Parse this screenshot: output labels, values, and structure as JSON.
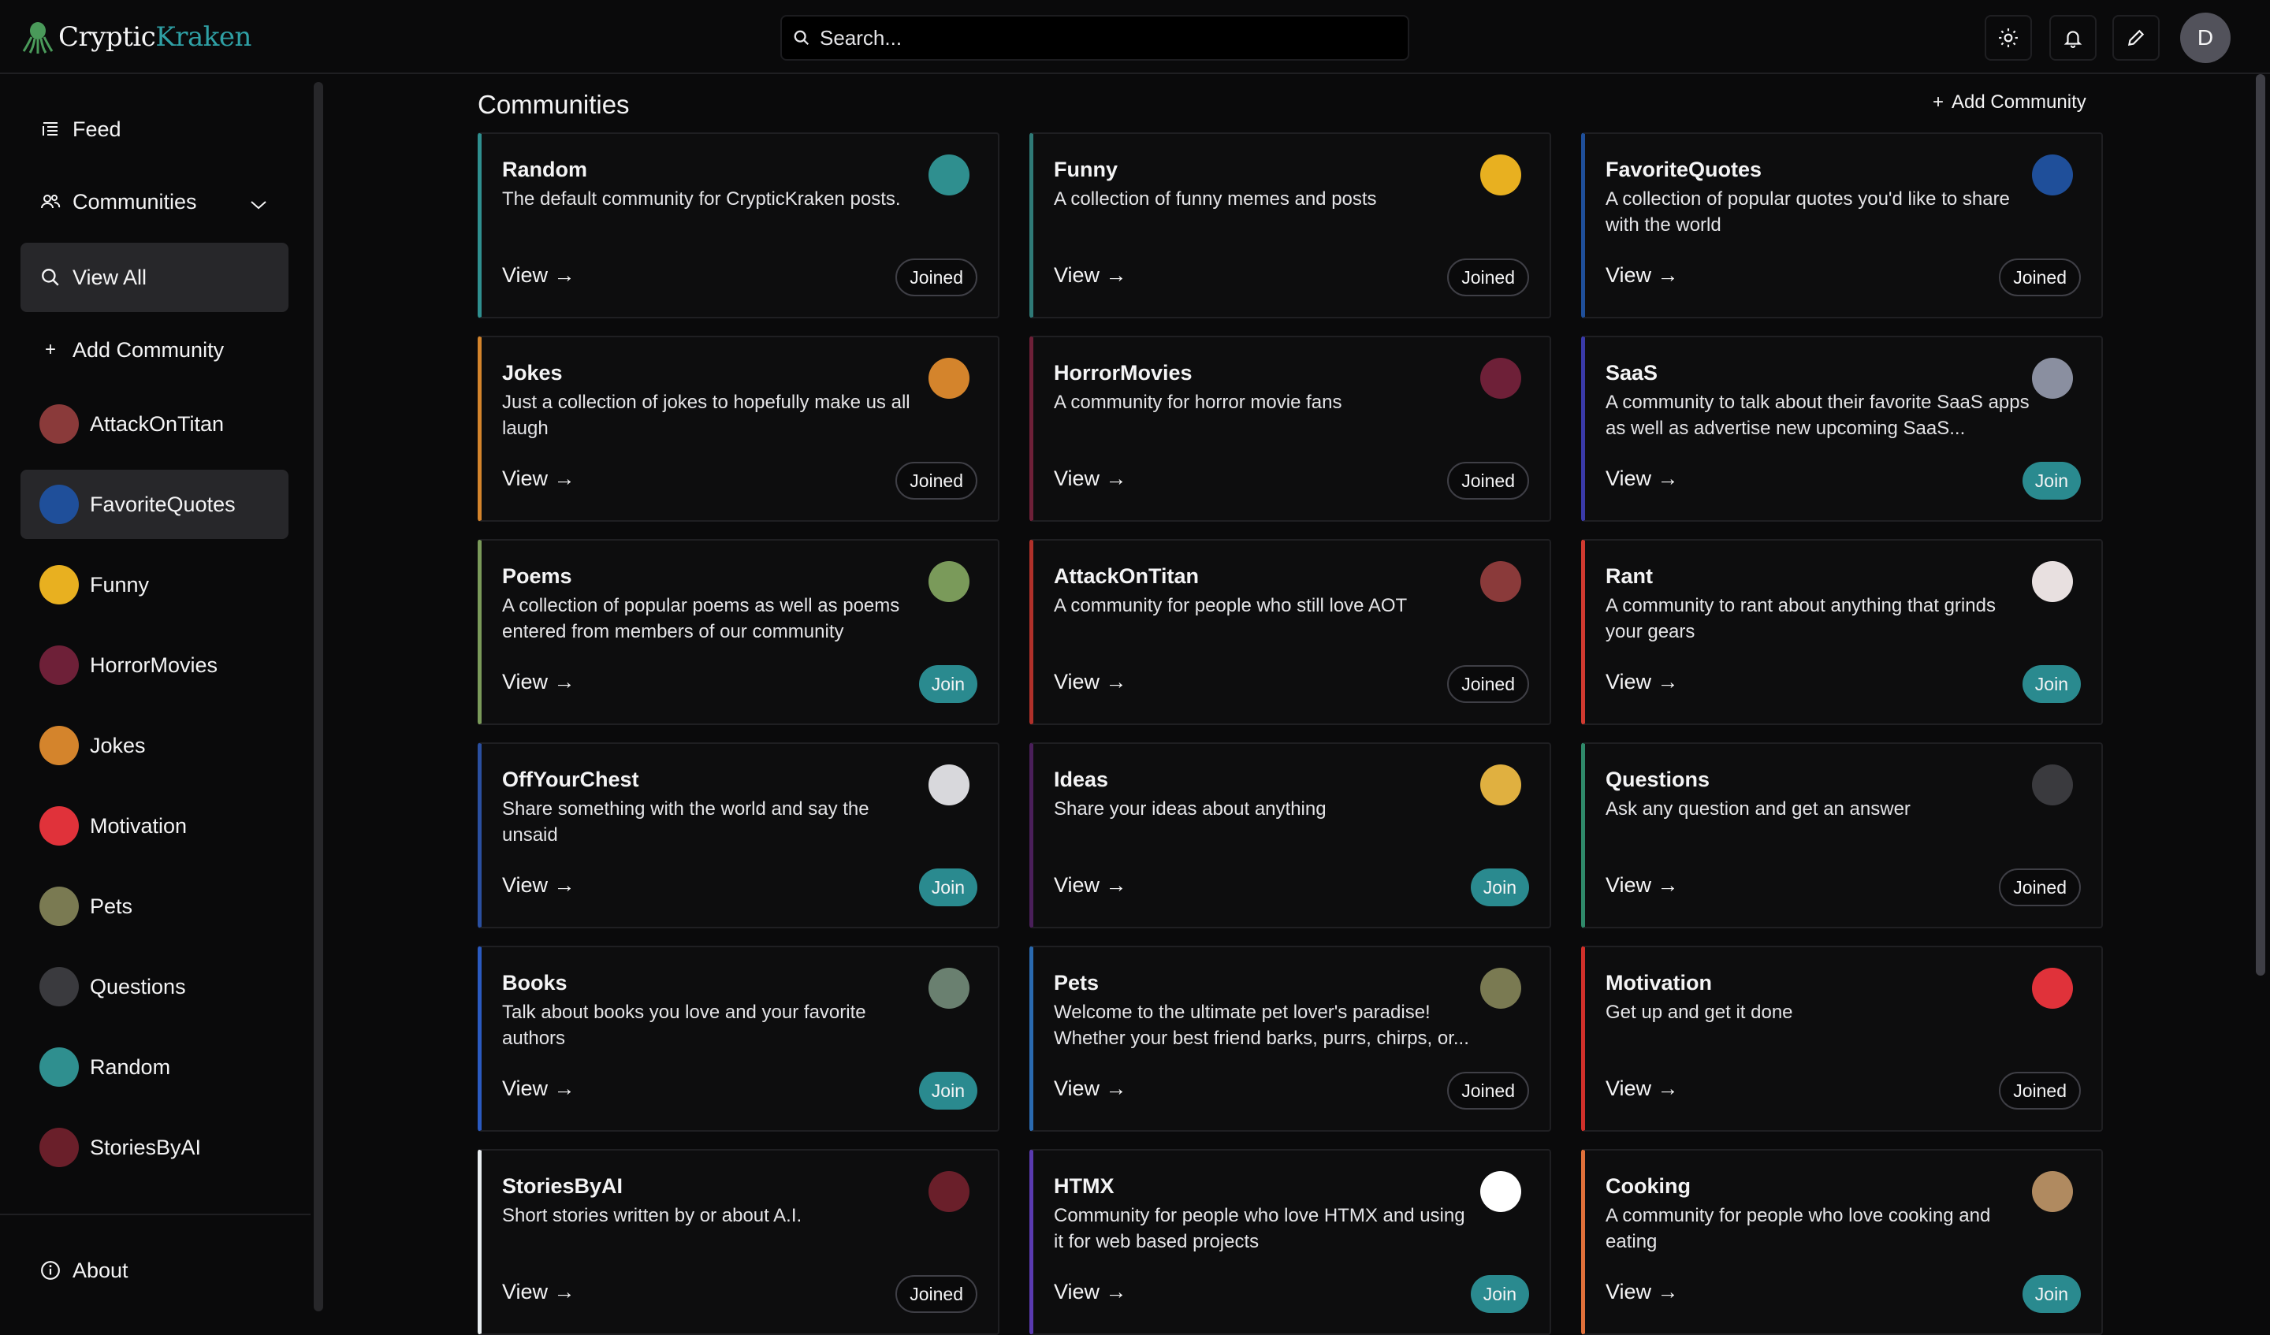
{
  "header": {
    "logo_a": "Cryptic",
    "logo_b": "Kraken",
    "search_placeholder": "Search...",
    "avatar_initial": "D",
    "icons": [
      "sun-icon",
      "bell-icon",
      "pencil-icon"
    ]
  },
  "sidebar": {
    "feed_label": "Feed",
    "communities_label": "Communities",
    "view_all_label": "View All",
    "add_community_label": "Add Community",
    "about_label": "About",
    "communities": [
      {
        "label": "AttackOnTitan",
        "color": "#8a3a3a"
      },
      {
        "label": "FavoriteQuotes",
        "color": "#1f4f9a"
      },
      {
        "label": "Funny",
        "color": "#e8b020"
      },
      {
        "label": "HorrorMovies",
        "color": "#6e2038"
      },
      {
        "label": "Jokes",
        "color": "#d4842c"
      },
      {
        "label": "Motivation",
        "color": "#e0323a"
      },
      {
        "label": "Pets",
        "color": "#7a7a52"
      },
      {
        "label": "Questions",
        "color": "#3a3a3e"
      },
      {
        "label": "Random",
        "color": "#2f8f8f"
      },
      {
        "label": "StoriesByAI",
        "color": "#6a1f2a"
      }
    ]
  },
  "main": {
    "title": "Communities",
    "add_community_label": "Add Community",
    "view_label": "View →",
    "cards": [
      {
        "name": "Random",
        "desc": "The default community for CrypticKraken posts.",
        "action": "Joined",
        "accent": "#2f8f8f",
        "avatar": "#2f8f8f"
      },
      {
        "name": "Funny",
        "desc": "A collection of funny memes and posts",
        "action": "Joined",
        "accent": "#2f7a77",
        "avatar": "#e8b020"
      },
      {
        "name": "FavoriteQuotes",
        "desc": "A collection of popular quotes you'd like to share with the world",
        "action": "Joined",
        "accent": "#1f4f9a",
        "avatar": "#1f4f9a"
      },
      {
        "name": "Jokes",
        "desc": "Just a collection of jokes to hopefully make us all laugh",
        "action": "Joined",
        "accent": "#d4842c",
        "avatar": "#d4842c"
      },
      {
        "name": "HorrorMovies",
        "desc": "A community for horror movie fans",
        "action": "Joined",
        "accent": "#6e2038",
        "avatar": "#6e2038"
      },
      {
        "name": "SaaS",
        "desc": "A community to talk about their favorite SaaS apps as well as advertise new upcoming SaaS...",
        "action": "Join",
        "accent": "#3a3aa8",
        "avatar": "#8a8fa0"
      },
      {
        "name": "Poems",
        "desc": "A collection of popular poems as well as poems entered from members of our community",
        "action": "Join",
        "accent": "#7a9a5a",
        "avatar": "#7a9a5a"
      },
      {
        "name": "AttackOnTitan",
        "desc": "A community for people who still love AOT",
        "action": "Joined",
        "accent": "#b0302a",
        "avatar": "#8a3a3a"
      },
      {
        "name": "Rant",
        "desc": "A community to rant about anything that grinds your gears",
        "action": "Join",
        "accent": "#d03a30",
        "avatar": "#e8e0e0"
      },
      {
        "name": "OffYourChest",
        "desc": "Share something with the world and say the unsaid",
        "action": "Join",
        "accent": "#2a4fa0",
        "avatar": "#d8d8dc"
      },
      {
        "name": "Ideas",
        "desc": "Share your ideas about anything",
        "action": "Join",
        "accent": "#4a1f5a",
        "avatar": "#e0b040"
      },
      {
        "name": "Questions",
        "desc": "Ask any question and get an answer",
        "action": "Joined",
        "accent": "#2f8a6a",
        "avatar": "#3a3a3e"
      },
      {
        "name": "Books",
        "desc": "Talk about books you love and your favorite authors",
        "action": "Join",
        "accent": "#2a5ac0",
        "avatar": "#6a8070"
      },
      {
        "name": "Pets",
        "desc": "Welcome to the ultimate pet lover's paradise! Whether your best friend barks, purrs, chirps, or...",
        "action": "Joined",
        "accent": "#2a6ab0",
        "avatar": "#7a7a52"
      },
      {
        "name": "Motivation",
        "desc": "Get up and get it done",
        "action": "Joined",
        "accent": "#d0302a",
        "avatar": "#e0323a"
      },
      {
        "name": "StoriesByAI",
        "desc": "Short stories written by or about A.I.",
        "action": "Joined",
        "accent": "#e8edf0",
        "avatar": "#6a1f2a"
      },
      {
        "name": "HTMX",
        "desc": "Community for people who love HTMX and using it for web based projects",
        "action": "Join",
        "accent": "#5a3ab0",
        "avatar": "#ffffff"
      },
      {
        "name": "Cooking",
        "desc": "A community for people who love cooking and eating",
        "action": "Join",
        "accent": "#e0703a",
        "avatar": "#b08a60"
      }
    ]
  }
}
